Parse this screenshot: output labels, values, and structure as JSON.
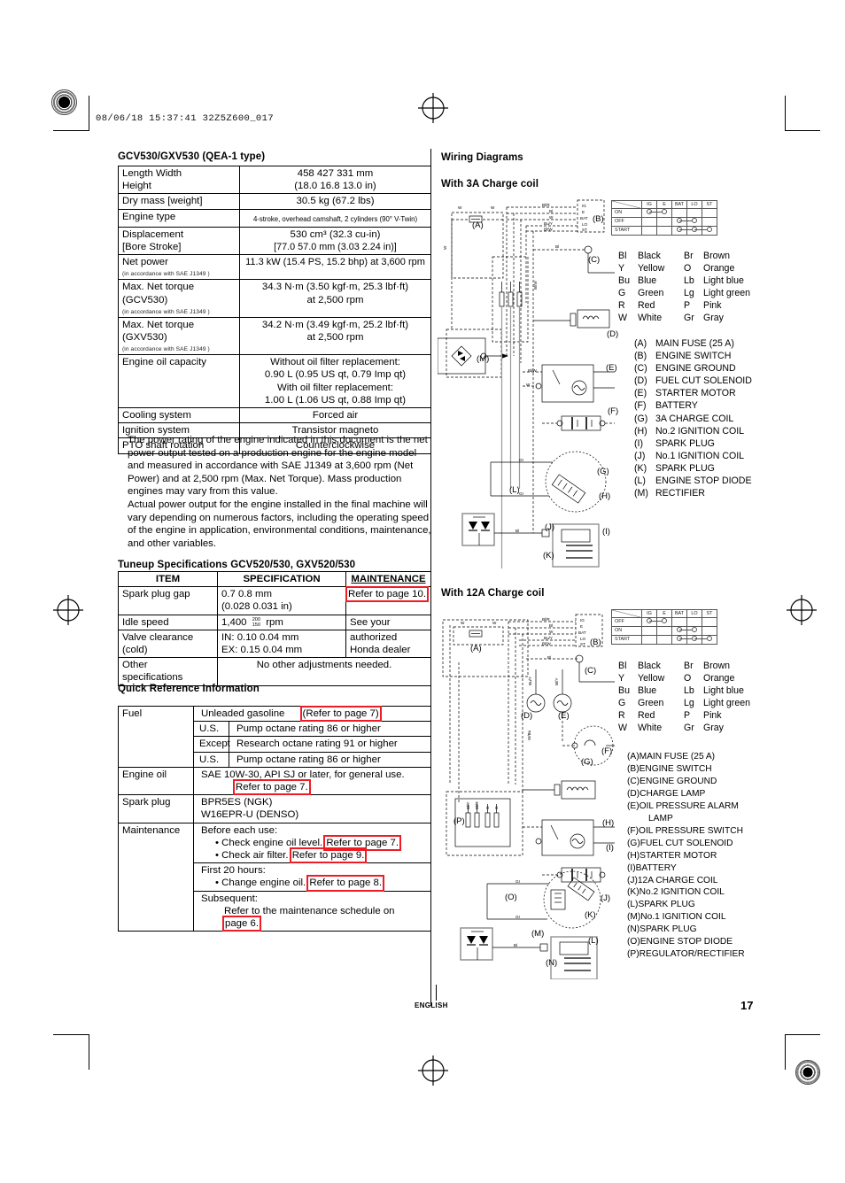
{
  "header": {
    "stamp": "08/06/18 15:37:41 32Z5Z600_017"
  },
  "footer": {
    "language": "ENGLISH",
    "page_number": "17"
  },
  "left": {
    "spec_title": "GCV530/GXV530  (QEA-1 type)",
    "spec_rows": [
      {
        "item_line1": "Length      Width",
        "item_line2": "Height",
        "val_line1": "458      427      331 mm",
        "val_line2": "(18.0      16.8      13.0 in)"
      },
      {
        "item_line1": "Dry mass [weight]",
        "val_line1": "30.5 kg (67.2 lbs)"
      },
      {
        "item_line1": "Engine type",
        "val_line1": "4-stroke, overhead camshaft, 2 cylinders (90° V-Twin)"
      },
      {
        "item_line1": "Displacement",
        "item_line2": "[Bore     Stroke]",
        "val_line1": "530 cm³ (32.3 cu-in)",
        "val_line2": "[77.0      57.0 mm (3.03      2.24 in)]"
      },
      {
        "item_line1": "Net power",
        "item_note": "(in accordance with SAE J1349 )",
        "val_line1": "11.3 kW (15.4 PS, 15.2 bhp) at 3,600 rpm"
      },
      {
        "item_line1": "Max. Net torque",
        "item_line2": "(GCV530)",
        "item_note": "(in accordance with SAE J1349 )",
        "val_line1": "34.3 N·m (3.50 kgf·m, 25.3 lbf·ft)",
        "val_line2": "at 2,500 rpm"
      },
      {
        "item_line1": "Max. Net torque",
        "item_line2": "(GXV530)",
        "item_note": "(in accordance with SAE J1349 )",
        "val_line1": "34.2 N·m (3.49 kgf·m, 25.2 lbf·ft)",
        "val_line2": "at 2,500 rpm"
      },
      {
        "item_line1": "Engine oil capacity",
        "val_line1": "Without oil filter replacement:",
        "val_line2": "0.90 L (0.95 US qt, 0.79 Imp qt)",
        "val_line3": "With oil filter replacement:",
        "val_line4": "1.00 L (1.06 US qt, 0.88 Imp qt)"
      },
      {
        "item_line1": "Cooling system",
        "val_line1": "Forced air"
      },
      {
        "item_line1": "Ignition system",
        "val_line1": "Transistor magneto"
      },
      {
        "item_line1": "PTO shaft rotation",
        "val_line1": "Counterclockwise"
      }
    ],
    "note_paragraph_1": "The power rating of the engine indicated in this document is the net power output tested on a production engine for the engine model and measured in accordance with SAE J1349 at 3,600 rpm (Net Power) and at 2,500 rpm (Max. Net Torque). Mass production engines may vary from this value.",
    "note_paragraph_2": "Actual power output for the engine installed in the final machine will vary depending on numerous factors, including the operating speed of the engine in application, environmental conditions, maintenance, and other variables.",
    "tuneup_title": "Tuneup Specifications   GCV520/530, GXV520/530",
    "tuneup_headers": {
      "item": "ITEM",
      "specification": "SPECIFICATION",
      "maintenance": "MAINTENANCE"
    },
    "tuneup_rows": [
      {
        "item": "Spark plug gap",
        "spec_line1": "0.7     0.8 mm",
        "spec_line2": "(0.028     0.031 in)",
        "maint": "Refer to page 10.",
        "maint_boxed": true
      },
      {
        "item": "Idle speed",
        "spec_line1": "1,400",
        "spec_tol_hi": "200",
        "spec_tol_lo": "150",
        "spec_unit": "rpm",
        "maint": "See your"
      },
      {
        "item": "Valve clearance",
        "item_line2": "(cold)",
        "spec_line1": "IN: 0.10        0.04 mm",
        "spec_line2": "EX: 0.15        0.04 mm",
        "maint": "authorized",
        "maint_line2": "Honda dealer"
      },
      {
        "item": "Other",
        "item_line2": "specifications",
        "spec_span": "No other adjustments needed."
      }
    ],
    "quickref_title": "Quick Reference Information",
    "quickref": {
      "fuel_label": "Fuel",
      "fuel_main": "Unleaded gasoline",
      "fuel_ref": "(Refer to page 7)",
      "fuel_sub": [
        {
          "region": "U.S.",
          "text": "Pump octane rating 86 or higher"
        },
        {
          "region": "Except",
          "text": "Research octane rating 91 or higher"
        },
        {
          "region": "U.S.",
          "text": "Pump octane rating 86 or higher"
        }
      ],
      "oil_label": "Engine oil",
      "oil_text": "SAE 10W-30, API SJ or later, for general use.",
      "oil_ref": "Refer to page 7.",
      "plug_label": "Spark plug",
      "plug_line1": "BPR5ES (NGK)",
      "plug_line2": "W16EPR-U (DENSO)",
      "maint_label": "Maintenance",
      "maint_g1_title": "Before each use:",
      "maint_g1_items": [
        {
          "text": "Check engine oil level.",
          "ref": "Refer to page 7."
        },
        {
          "text": "Check air filter.",
          "ref": "Refer to page 9."
        }
      ],
      "maint_g2_title": "First 20 hours:",
      "maint_g2_items": [
        {
          "text": "Change engine oil.",
          "ref": "Refer to page 8."
        }
      ],
      "maint_g3_title": "Subsequent:",
      "maint_g3_text": "Refer to the maintenance schedule on",
      "maint_g3_ref": "page 6."
    }
  },
  "right": {
    "wiring_title": "Wiring Diagrams",
    "diagram_3a": {
      "subtitle": "With 3A Charge coil",
      "switch_table": {
        "columns": [
          "IG",
          "E",
          "BAT",
          "LO",
          "ST"
        ],
        "rows": [
          {
            "label": "ON",
            "dots": [
              1,
              1,
              0,
              0,
              0
            ]
          },
          {
            "label": "OFF",
            "dots": [
              0,
              0,
              1,
              1,
              0
            ]
          },
          {
            "label": "START",
            "dots": [
              0,
              0,
              1,
              1,
              1
            ]
          }
        ]
      },
      "color_key": [
        {
          "ab": "Bl",
          "name": "Black",
          "ab2": "Br",
          "name2": "Brown"
        },
        {
          "ab": "Y",
          "name": "Yellow",
          "ab2": "O",
          "name2": "Orange"
        },
        {
          "ab": "Bu",
          "name": "Blue",
          "ab2": "Lb",
          "name2": "Light blue"
        },
        {
          "ab": "G",
          "name": "Green",
          "ab2": "Lg",
          "name2": "Light green"
        },
        {
          "ab": "R",
          "name": "Red",
          "ab2": "P",
          "name2": "Pink"
        },
        {
          "ab": "W",
          "name": "White",
          "ab2": "Gr",
          "name2": "Gray"
        }
      ],
      "legend": [
        {
          "key": "(A)",
          "label": "MAIN FUSE (25 A)"
        },
        {
          "key": "(B)",
          "label": "ENGINE SWITCH"
        },
        {
          "key": "(C)",
          "label": "ENGINE GROUND"
        },
        {
          "key": "(D)",
          "label": "FUEL CUT SOLENOID"
        },
        {
          "key": "(E)",
          "label": "STARTER MOTOR"
        },
        {
          "key": "(F)",
          "label": "BATTERY"
        },
        {
          "key": "(G)",
          "label": "3A CHARGE COIL"
        },
        {
          "key": "(H)",
          "label": "No.2 IGNITION COIL"
        },
        {
          "key": "(I)",
          "label": "SPARK PLUG"
        },
        {
          "key": "(J)",
          "label": "No.1 IGNITION COIL"
        },
        {
          "key": "(K)",
          "label": "SPARK PLUG"
        },
        {
          "key": "(L)",
          "label": "ENGINE STOP DIODE"
        },
        {
          "key": "(M)",
          "label": "RECTIFIER"
        }
      ],
      "wire_labels": [
        "Bl/R",
        "Bl",
        "W",
        "Bu/Y",
        "Bl/W",
        "Gr",
        "Bu/Y",
        "Bl/W",
        "W"
      ],
      "terminals": [
        "IG",
        "E",
        "BAT",
        "LO",
        "ST"
      ],
      "callouts": [
        "(A)",
        "(B)",
        "(C)",
        "(D)",
        "(E)",
        "(F)",
        "(G)",
        "(H)",
        "(I)",
        "(J)",
        "(K)",
        "(L)",
        "(M)"
      ]
    },
    "diagram_12a": {
      "subtitle": "With 12A Charge coil",
      "switch_table": {
        "columns": [
          "IG",
          "E",
          "BAT",
          "LO",
          "ST"
        ],
        "rows": [
          {
            "label": "OFF",
            "dots": [
              1,
              1,
              0,
              0,
              0
            ]
          },
          {
            "label": "ON",
            "dots": [
              0,
              0,
              1,
              1,
              0
            ]
          },
          {
            "label": "START",
            "dots": [
              0,
              0,
              1,
              1,
              1
            ]
          }
        ]
      },
      "color_key": [
        {
          "ab": "Bl",
          "name": "Black",
          "ab2": "Br",
          "name2": "Brown"
        },
        {
          "ab": "Y",
          "name": "Yellow",
          "ab2": "O",
          "name2": "Orange"
        },
        {
          "ab": "Bu",
          "name": "Blue",
          "ab2": "Lb",
          "name2": "Light blue"
        },
        {
          "ab": "G",
          "name": "Green",
          "ab2": "Lg",
          "name2": "Light green"
        },
        {
          "ab": "R",
          "name": "Red",
          "ab2": "P",
          "name2": "Pink"
        },
        {
          "ab": "W",
          "name": "White",
          "ab2": "Gr",
          "name2": "Gray"
        }
      ],
      "legend": [
        {
          "key": "(A)",
          "label": "MAIN FUSE (25 A)"
        },
        {
          "key": "(B)",
          "label": "ENGINE SWITCH"
        },
        {
          "key": "(C)",
          "label": "ENGINE GROUND"
        },
        {
          "key": "(D)",
          "label": "CHARGE LAMP"
        },
        {
          "key": "(E)",
          "label": "OIL PRESSURE ALARM",
          "label2": "LAMP"
        },
        {
          "key": "(F)",
          "label": "OIL PRESSURE SWITCH"
        },
        {
          "key": "(G)",
          "label": "FUEL CUT SOLENOID"
        },
        {
          "key": "(H)",
          "label": "STARTER MOTOR"
        },
        {
          "key": "(I)",
          "label": "BATTERY"
        },
        {
          "key": "(J)",
          "label": "12A CHARGE COIL"
        },
        {
          "key": "(K)",
          "label": "No.2 IGNITION COIL"
        },
        {
          "key": "(L)",
          "label": "SPARK PLUG"
        },
        {
          "key": "(M)",
          "label": "No.1 IGNITION COIL"
        },
        {
          "key": "(N)",
          "label": "SPARK PLUG"
        },
        {
          "key": "(O)",
          "label": "ENGINE STOP DIODE"
        },
        {
          "key": "(P)",
          "label": "REGULATOR/RECTIFIER"
        }
      ],
      "wire_labels": [
        "Bl/R",
        "Bl",
        "W",
        "Bu/Y",
        "Bl/W",
        "Bl",
        "Bu/Y",
        "Bl/Y",
        "W/Bu",
        "Gr",
        "Bl"
      ],
      "terminals": [
        "IG",
        "E",
        "BAT",
        "LO",
        "ST"
      ]
    }
  }
}
